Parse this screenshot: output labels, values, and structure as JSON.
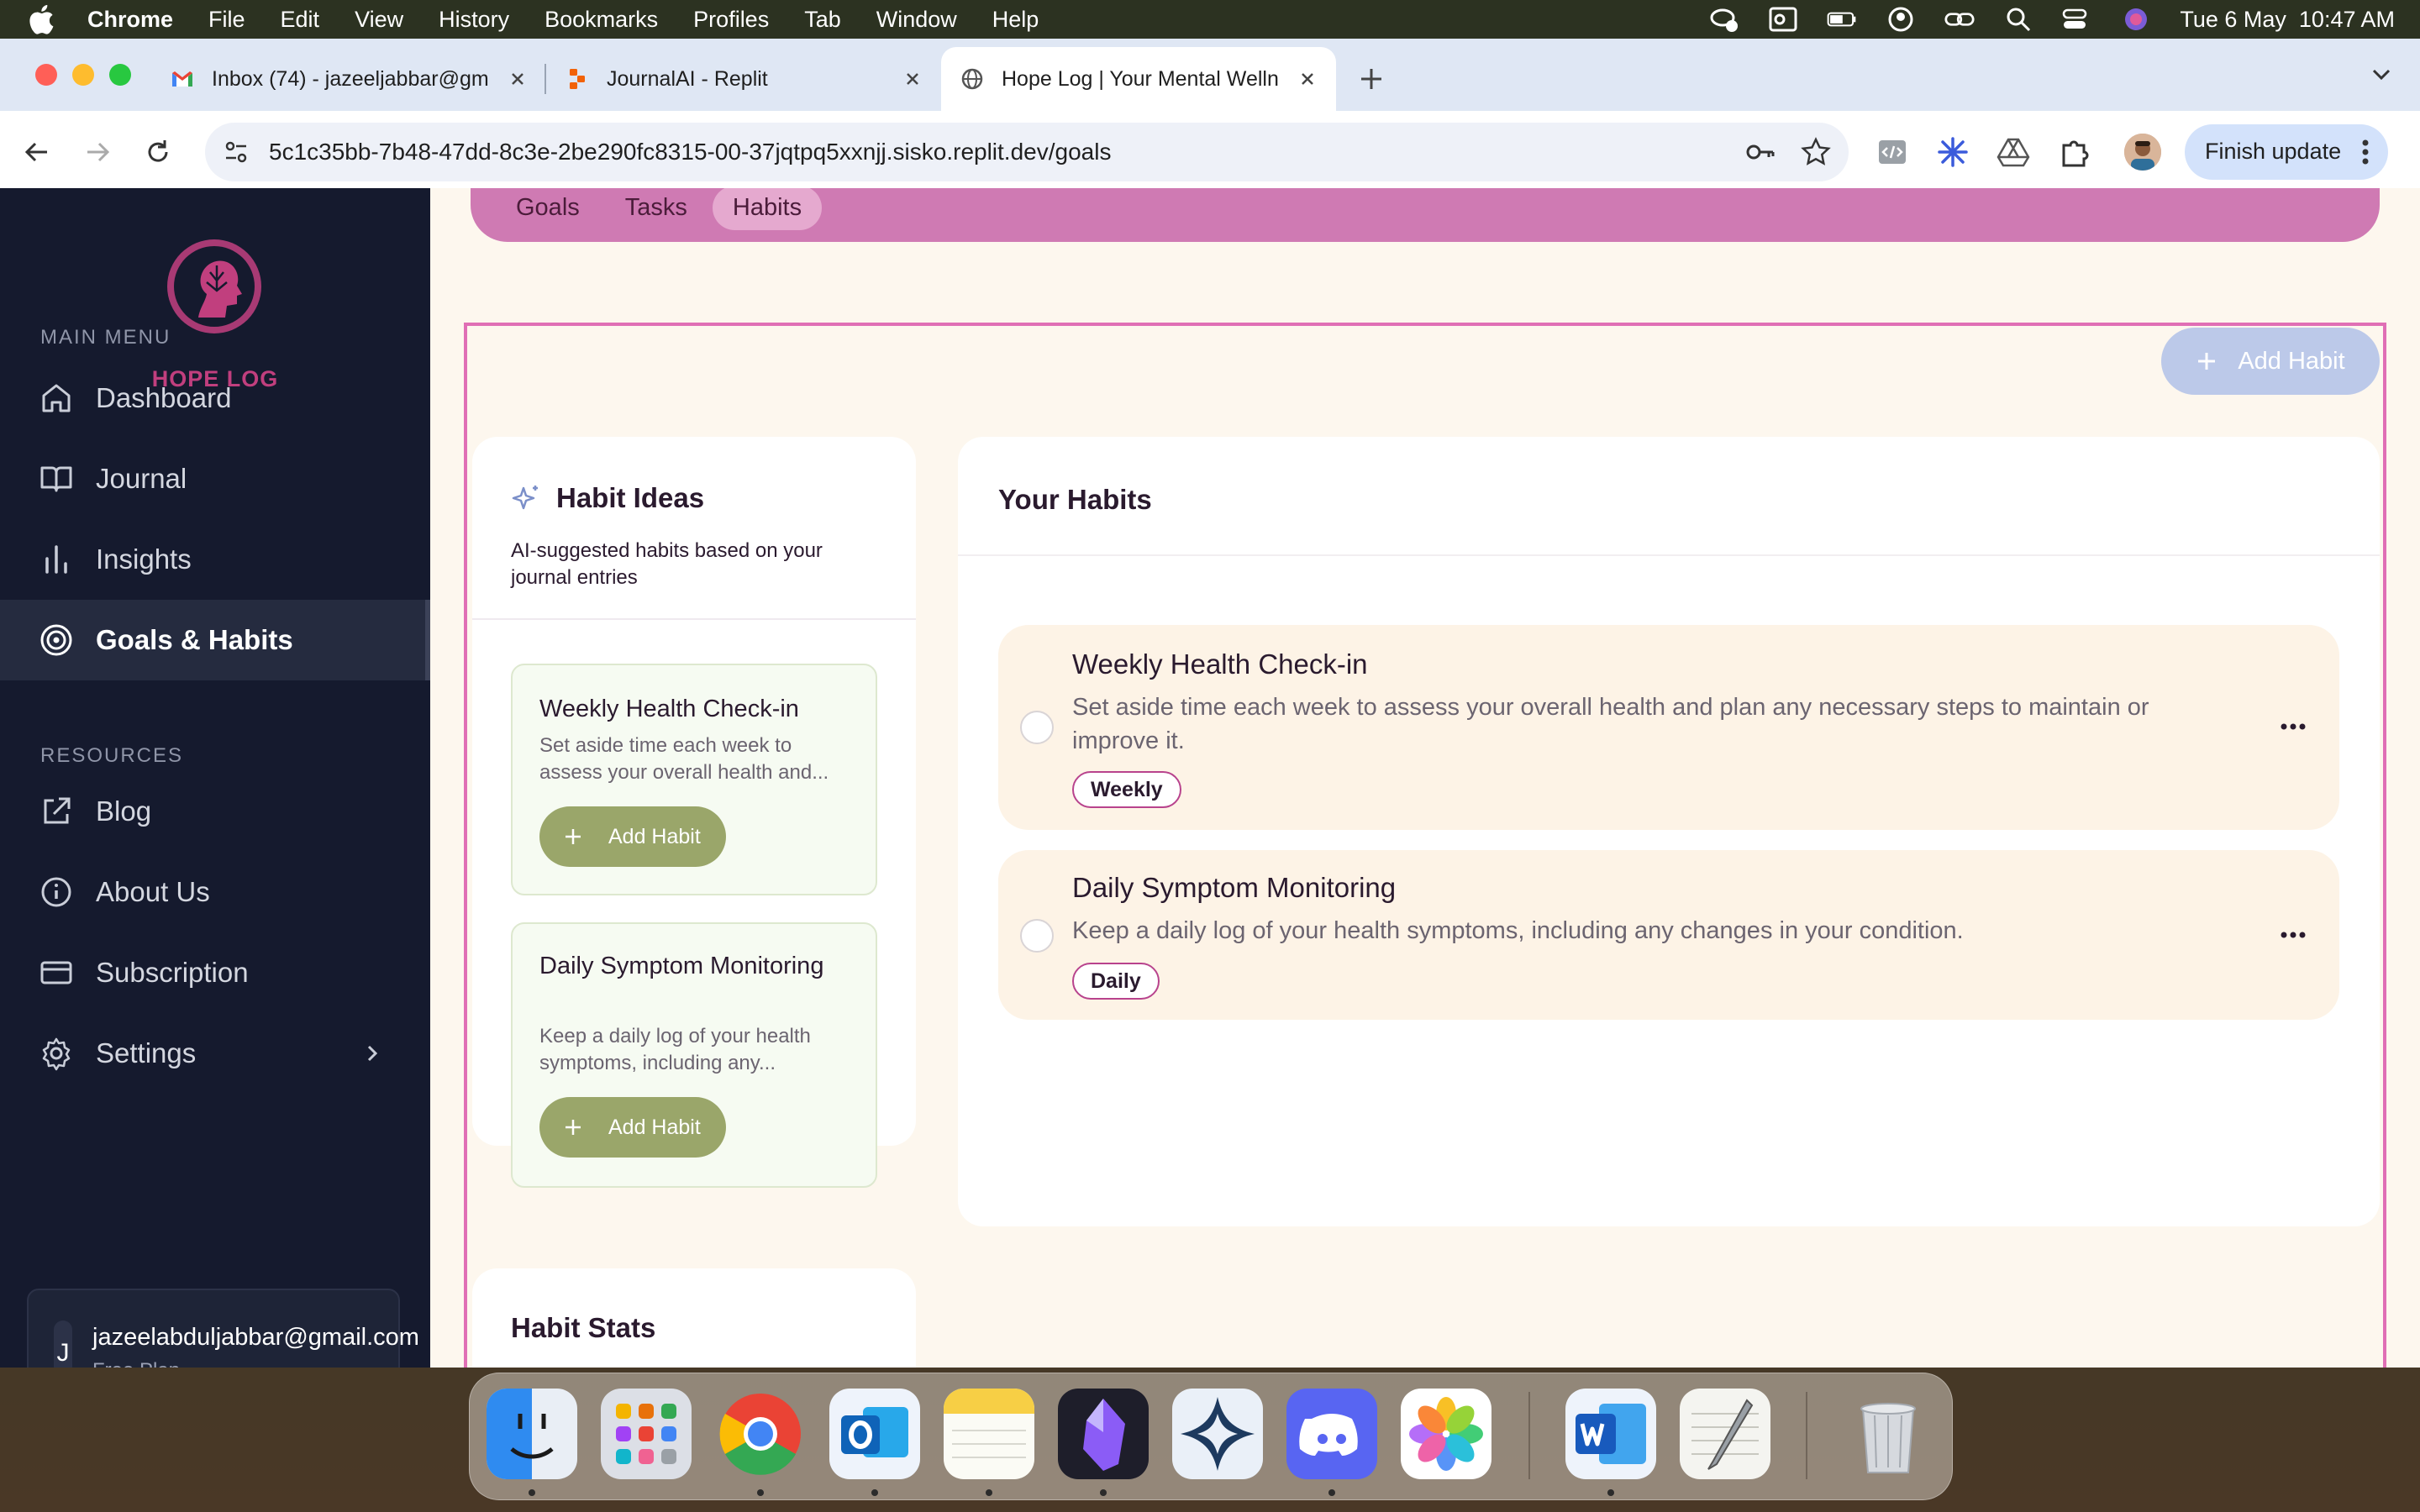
{
  "menubar": {
    "app": "Chrome",
    "items": [
      "File",
      "Edit",
      "View",
      "History",
      "Bookmarks",
      "Profiles",
      "Tab",
      "Window",
      "Help"
    ],
    "datetime": "Tue 6 May  10:47 AM"
  },
  "browser": {
    "tabs": [
      {
        "title": "Inbox (74) - jazeeljabbar@gm",
        "icon": "gmail-icon"
      },
      {
        "title": "JournalAI - Replit",
        "icon": "replit-icon"
      },
      {
        "title": "Hope Log | Your Mental Welln",
        "icon": "globe-icon"
      }
    ],
    "url_host": "5c1c35bb-7b48-47dd-8c3e-2be290fc8315-00-37jqtpq5xxnjj.sisko.replit.dev",
    "url_path": "/goals",
    "finish_update": "Finish update"
  },
  "sidebar": {
    "logo_text": "HOPE LOG",
    "main_menu_label": "MAIN MENU",
    "resources_label": "RESOURCES",
    "main_items": [
      {
        "label": "Dashboard",
        "icon": "home-icon"
      },
      {
        "label": "Journal",
        "icon": "book-icon"
      },
      {
        "label": "Insights",
        "icon": "bar-chart-icon"
      },
      {
        "label": "Goals & Habits",
        "icon": "target-icon",
        "active": true
      }
    ],
    "resource_items": [
      {
        "label": "Blog",
        "icon": "external-link-icon"
      },
      {
        "label": "About Us",
        "icon": "info-icon"
      },
      {
        "label": "Subscription",
        "icon": "credit-card-icon"
      },
      {
        "label": "Settings",
        "icon": "gear-icon"
      }
    ],
    "user": {
      "initial": "J",
      "email": "jazeelabduljabbar@gmail.com",
      "plan": "Free Plan"
    }
  },
  "subnav": {
    "tabs": [
      "Goals",
      "Tasks",
      "Habits"
    ],
    "active": "Habits"
  },
  "add_habit_label": "Add Habit",
  "habit_ideas": {
    "title": "Habit Ideas",
    "description": "AI-suggested habits based on your journal entries",
    "items": [
      {
        "title": "Weekly Health Check-in",
        "description": "Set aside time each week to assess your overall health and...",
        "button": "Add Habit"
      },
      {
        "title": "Daily Symptom Monitoring",
        "description": "Keep a daily log of your health symptoms, including any...",
        "button": "Add Habit"
      }
    ]
  },
  "habit_stats": {
    "title": "Habit Stats"
  },
  "your_habits": {
    "title": "Your Habits",
    "items": [
      {
        "title": "Weekly Health Check-in",
        "description": "Set aside time each week to assess your overall health and plan any necessary steps to maintain or improve it.",
        "frequency": "Weekly"
      },
      {
        "title": "Daily Symptom Monitoring",
        "description": "Keep a daily log of your health symptoms, including any changes in your condition.",
        "frequency": "Daily"
      }
    ]
  },
  "colors": {
    "sidebar_bg": "#151a2e",
    "accent_pink": "#cf7ab3",
    "frame_pink": "#e06fb5",
    "olive_button": "#9aa66a",
    "page_bg": "#fdf7ee"
  },
  "dock": [
    "finder-icon",
    "launchpad-icon",
    "chrome-icon",
    "outlook-icon",
    "notes-icon",
    "obsidian-icon",
    "spark-icon",
    "discord-icon",
    "photos-icon",
    "word-icon",
    "textedit-icon",
    "trash-icon"
  ]
}
